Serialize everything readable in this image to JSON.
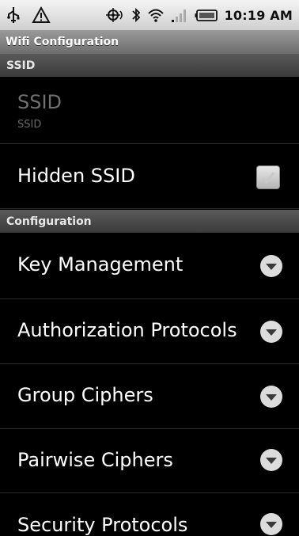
{
  "status_bar": {
    "time": "10:19 AM",
    "icons": [
      "usb-icon",
      "warning-icon",
      "gps-icon",
      "bluetooth-icon",
      "wifi-icon",
      "signal-icon",
      "battery-icon"
    ]
  },
  "title": "Wifi Configuration",
  "sections": {
    "ssid": {
      "header": "SSID",
      "ssid_pref": {
        "title": "SSID",
        "summary": "SSID"
      },
      "hidden_pref": {
        "title": "Hidden SSID",
        "checked": true
      }
    },
    "configuration": {
      "header": "Configuration",
      "items": [
        {
          "label": "Key Management",
          "icon": "chevron-down-icon"
        },
        {
          "label": "Authorization Protocols",
          "icon": "chevron-down-icon"
        },
        {
          "label": "Group Ciphers",
          "icon": "chevron-down-icon"
        },
        {
          "label": "Pairwise Ciphers",
          "icon": "chevron-down-icon"
        },
        {
          "label": "Security Protocols",
          "icon": "chevron-down-icon"
        }
      ]
    }
  },
  "colors": {
    "background": "#000000",
    "titlebar": "#7f7f7f",
    "section_header": "#4a4a4a",
    "disabled_text": "#707070"
  }
}
